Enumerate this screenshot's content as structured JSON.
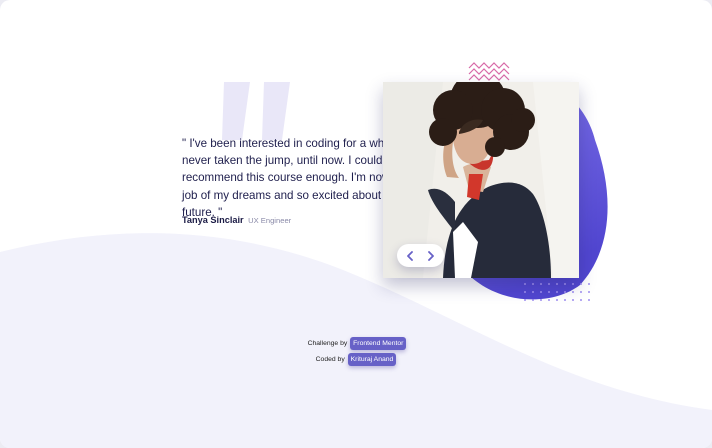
{
  "testimonial": {
    "quote": "\" I've been interested in coding for a while but never taken the jump, until now. I couldn't recommend this course enough. I'm now in th job of my dreams and so excited about the future. \"",
    "author_name": "Tanya Sinclair",
    "author_role": "UX Engineer"
  },
  "photo": {
    "alt": "Tanya Sinclair"
  },
  "slider": {
    "prev_icon": "chevron-left-icon",
    "next_icon": "chevron-right-icon"
  },
  "attribution": {
    "challenge_text": "Challenge by",
    "challenge_link": "Frontend Mentor",
    "coded_text": "Coded by",
    "coded_link": "Krituraj Anand"
  },
  "colors": {
    "accent": "#6761c7",
    "dark_navy": "#1f1f4d",
    "light_bg": "#f1f1fb",
    "purple_gradient_start": "#8a7ef0",
    "purple_gradient_end": "#5146d0"
  }
}
